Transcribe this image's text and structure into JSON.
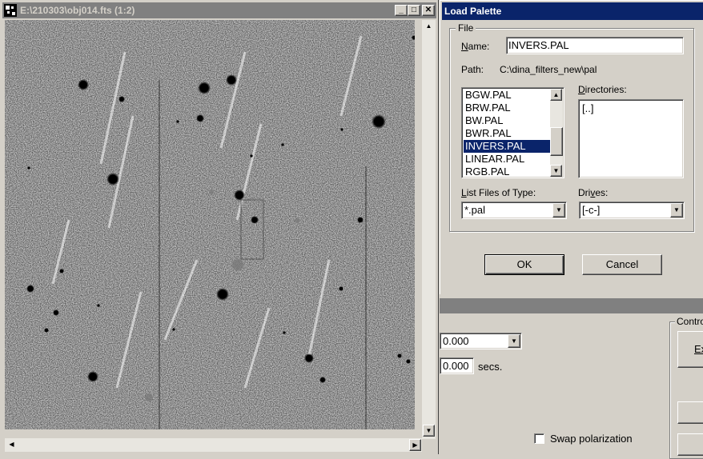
{
  "image_window": {
    "title": "E:\\210303\\obj014.fts (1:2)",
    "minimize_glyph": "_",
    "maximize_glyph": "□",
    "close_glyph": "✕",
    "scroll_up_glyph": "▲",
    "scroll_down_glyph": "▼",
    "scroll_left_glyph": "◀",
    "scroll_right_glyph": "▶"
  },
  "dialog": {
    "title": "Load Palette",
    "group_label": "File",
    "name_label_u": "N",
    "name_label_rest": "ame:",
    "name_value": "INVERS.PAL",
    "path_label": "Path:",
    "path_value": "C:\\dina_filters_new\\pal",
    "files": [
      {
        "label": "BGW.PAL",
        "selected": false
      },
      {
        "label": "BRW.PAL",
        "selected": false
      },
      {
        "label": "BW.PAL",
        "selected": false
      },
      {
        "label": "BWR.PAL",
        "selected": false
      },
      {
        "label": "INVERS.PAL",
        "selected": true
      },
      {
        "label": "LINEAR.PAL",
        "selected": false
      },
      {
        "label": "RGB.PAL",
        "selected": false
      }
    ],
    "directories_label_u": "D",
    "directories_label_rest": "irectories:",
    "directories": [
      "[..]"
    ],
    "list_type_label_pre": "L",
    "list_type_label_rest": "ist Files of Type:",
    "list_type_value": "*.pal",
    "drives_label_pre": "Dri",
    "drives_label_u": "v",
    "drives_label_rest": "es:",
    "drives_value": "[-c-]",
    "ok_label": "OK",
    "cancel_label": "Cancel"
  },
  "background_window": {
    "field1_value": "0.000",
    "field2_value": "0.000",
    "field2_unit": "secs.",
    "group_label": "Contro",
    "button_label": "Ex",
    "swap_label": "Swap polarization",
    "swap_checked": false
  },
  "colors": {
    "active_title": "#0a246a",
    "inactive_title": "#808080",
    "face": "#d4d0c8"
  }
}
